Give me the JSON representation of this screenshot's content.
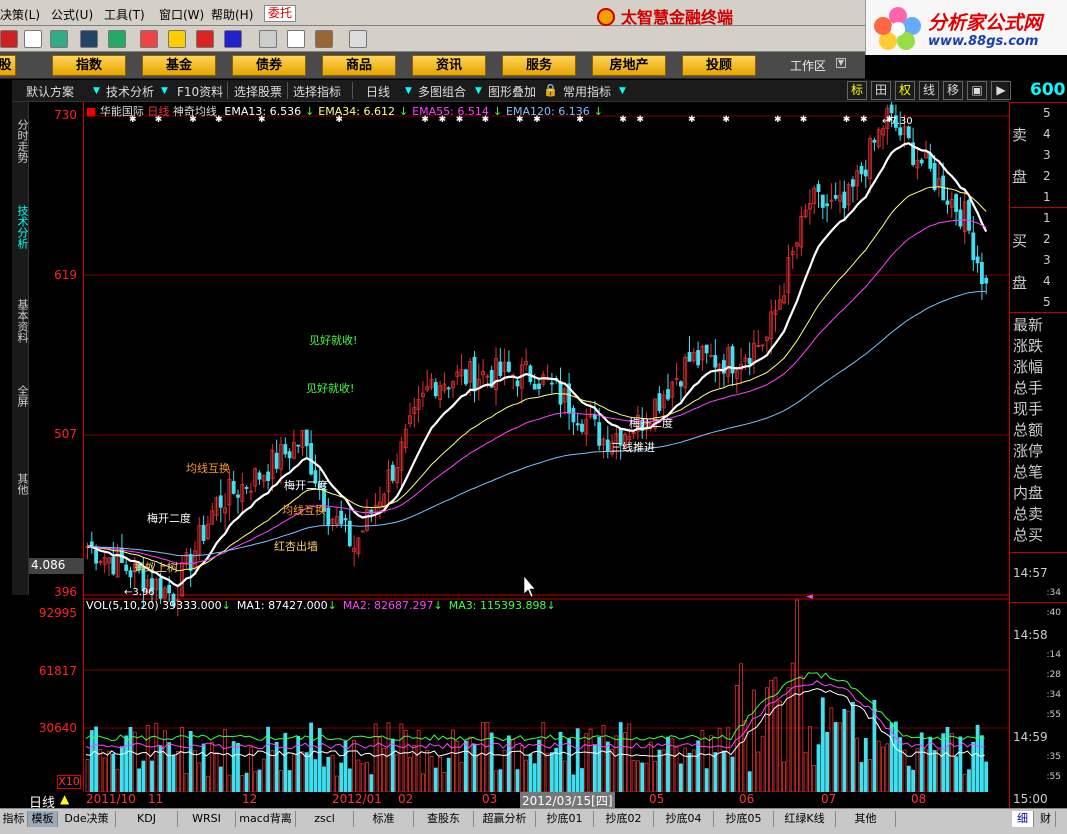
{
  "menu": {
    "items": [
      "决策(L)",
      "公式(U)",
      "工具(T)",
      "窗口(W)",
      "帮助(H)"
    ],
    "active_tab": "委托"
  },
  "brand": {
    "title": "太智慧金融终端"
  },
  "logo": {
    "line1": "分析家公式网",
    "line2": "www.88gs.com"
  },
  "nav": {
    "buttons": [
      "股",
      "指数",
      "基金",
      "债券",
      "商品",
      "资讯",
      "服务",
      "房地产",
      "投顾"
    ],
    "workarea": "工作区"
  },
  "func_bar": {
    "items": [
      "默认方案",
      "技术分析",
      "F10资料",
      "选择股票",
      "选择指标",
      "日线",
      "多图组合",
      "图形叠加",
      "常用指标"
    ],
    "right_tabs": [
      "标",
      "田",
      "权",
      "线",
      "移",
      "",
      ""
    ],
    "big_number": "600"
  },
  "left_tabs": [
    "分时走势",
    "技术分析",
    "基本资料",
    "全屏",
    "其他"
  ],
  "stock": {
    "name": "华能国际",
    "period": "日线",
    "indicator": "神奇均线"
  },
  "legend_main": [
    {
      "label": "EMA13: 6.536",
      "color": "#ffffff"
    },
    {
      "label": "EMA34: 6.612",
      "color": "#ffff80"
    },
    {
      "label": "EMA55: 6.514",
      "color": "#ff40ff"
    },
    {
      "label": "EMA120: 6.136",
      "color": "#80c0ff"
    }
  ],
  "legend_vol": [
    {
      "label": "VOL(5,10,20) 39333.000",
      "color": "#ffffff"
    },
    {
      "label": "MA1: 87427.000",
      "color": "#ffffff"
    },
    {
      "label": "MA2: 82687.297",
      "color": "#ff40ff"
    },
    {
      "label": "MA3: 115393.898",
      "color": "#40ff40"
    }
  ],
  "y_axis_price": [
    "730",
    "619",
    "507",
    "396"
  ],
  "current_value": "4.086",
  "y_axis_vol": [
    "92995",
    "61817",
    "30640"
  ],
  "x10_label": "X10",
  "annotations": [
    {
      "text": "见好就收!",
      "color": "#40ff40"
    },
    {
      "text": "见好就收!",
      "color": "#40ff40"
    },
    {
      "text": "均线互换",
      "color": "#ff9a30"
    },
    {
      "text": "梅开二度",
      "color": "#ffffff"
    },
    {
      "text": "梅开二度",
      "color": "#ffffff"
    },
    {
      "text": "均线互换",
      "color": "#ff9a30"
    },
    {
      "text": "红杏出墙",
      "color": "#ffcc66"
    },
    {
      "text": "蚂蚁上树",
      "color": "#ffcc66"
    },
    {
      "text": "梅开二度",
      "color": "#ffffff"
    },
    {
      "text": "三线推进",
      "color": "#ffffff"
    }
  ],
  "extremes": {
    "high_label": "7.30",
    "low_label": "3.96"
  },
  "date_axis": {
    "day_label": "日线",
    "labels": [
      "2011/10",
      "11",
      "12",
      "2012/01",
      "02",
      "03",
      "04",
      "05",
      "06",
      "07",
      "08"
    ],
    "highlighted": "2012/03/15[四]"
  },
  "order_book": {
    "sell_label": [
      "卖",
      "盘"
    ],
    "buy_label": [
      "买",
      "盘"
    ],
    "sell_nums": [
      "5",
      "4",
      "3",
      "2",
      "1"
    ],
    "sell_vols": [
      "5",
      "4",
      "3",
      "2",
      "1"
    ],
    "buy_nums": [
      "1",
      "2",
      "3",
      "4",
      "5"
    ],
    "buy_vols": [
      "1",
      "2",
      "3",
      "4",
      "5"
    ]
  },
  "stats_labels": [
    "最新",
    "涨跌",
    "涨幅",
    "总手",
    "现手",
    "总额",
    "涨停",
    "总笔",
    "内盘",
    "总卖",
    "总买"
  ],
  "ticks": [
    {
      "time": "14:57",
      "small": [
        ":34",
        ":40"
      ]
    },
    {
      "time": "14:58",
      "small": [
        ":14",
        ":28",
        ":34",
        ":55"
      ]
    },
    {
      "time": "14:59",
      "small": [
        ":35",
        ":55"
      ]
    },
    {
      "time": "15:00",
      "small": []
    }
  ],
  "bottom_tabs": [
    "指标",
    "模板",
    "Dde决策",
    "KDJ",
    "WRSI",
    "macd背离",
    "zscl",
    "标准",
    "查股东",
    "超赢分析",
    "抄底01",
    "抄底02",
    "抄底04",
    "抄底05",
    "红绿K线",
    "其他",
    "细",
    "财"
  ],
  "chart_data": {
    "type": "candlestick",
    "title": "华能国际 日线 神奇均线",
    "ylim": [
      3.96,
      7.3
    ],
    "volume_ylim": [
      0,
      92995
    ],
    "series": [
      {
        "name": "EMA13",
        "color": "#ffffff"
      },
      {
        "name": "EMA34",
        "color": "#ffff80"
      },
      {
        "name": "EMA55",
        "color": "#ff40ff"
      },
      {
        "name": "EMA120",
        "color": "#80c0ff"
      }
    ]
  },
  "colors": {
    "up": "#e03030",
    "down": "#40e0f0",
    "axis": "#c00000",
    "grid": "#800000"
  }
}
